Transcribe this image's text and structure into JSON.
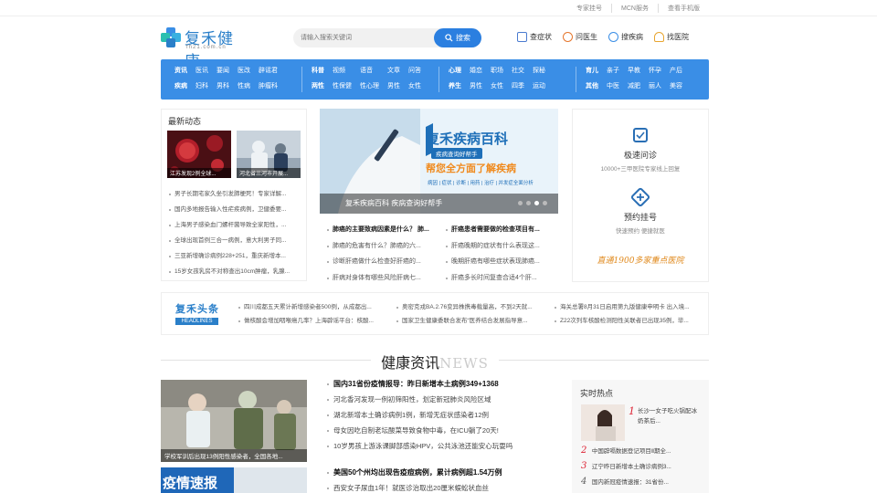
{
  "topbar": {
    "links": [
      "专家挂号",
      "MCN服务",
      "查看手机版"
    ]
  },
  "logo": {
    "name": "复禾健康",
    "domain": "fh21.com.cn"
  },
  "search": {
    "placeholder": "请输入搜索关键词",
    "button": "搜索"
  },
  "header_nav": [
    {
      "label": "查症状",
      "icon": "book-icon",
      "color": "#4a7bd0"
    },
    {
      "label": "问医生",
      "icon": "doctor-icon",
      "color": "#e5762c"
    },
    {
      "label": "搜疾病",
      "icon": "disease-icon",
      "color": "#3a8ee6"
    },
    {
      "label": "找医院",
      "icon": "hospital-icon",
      "color": "#e8a530"
    }
  ],
  "categories": [
    {
      "row1": [
        "资讯",
        "医讯",
        "要闻",
        "医改",
        "辟谣君"
      ],
      "row2": [
        "疾病",
        "妇科",
        "男科",
        "性病",
        "肿瘤科"
      ],
      "bold": [
        0
      ]
    },
    {
      "row1": [
        "科普",
        "视频",
        "语音",
        "文章",
        "问答"
      ],
      "row2": [
        "两性",
        "性保健",
        "性心理",
        "男性",
        "女性"
      ],
      "bold": [
        0
      ]
    },
    {
      "row1": [
        "心理",
        "婚恋",
        "职场",
        "社交",
        "探秘"
      ],
      "row2": [
        "养生",
        "男性",
        "女性",
        "四季",
        "运动"
      ],
      "bold": [
        0
      ]
    },
    {
      "row1": [
        "育儿",
        "亲子",
        "早教",
        "怀孕",
        "产后"
      ],
      "row2": [
        "其他",
        "中医",
        "减肥",
        "丽人",
        "美容"
      ],
      "bold": [
        0
      ]
    }
  ],
  "latest": {
    "title": "最新动态",
    "thumbs": [
      "江苏发现2例全球...",
      "河北省三河市开展..."
    ],
    "items": [
      "男子长期宅家久坐引发肺梗死！专家详解...",
      "国内多地报告输入性疟疾病例，卫健委要...",
      "上海男子感染血门螺杆菌导致全家阳性，...",
      "全球出现首例三合一病例，意大利男子同...",
      "三亚新增确诊病例228+251，重庆新增本...",
      "15岁女孩乳房不对称查出10cm肿瘤，乳腺..."
    ]
  },
  "banner": {
    "title": "复禾疾病百科",
    "tag": "疾病查询好帮手",
    "slogan": "帮您全方面了解疾病",
    "subline": "病因 | 症状 | 诊断 | 用药 | 治疗 | 并发症全面分析",
    "caption": "复禾疾病百科 疾病查询好帮手"
  },
  "mid_news": [
    {
      "text": "肺癌的主要致病因素是什么？ 肺...",
      "bold": true
    },
    {
      "text": "肝癌患者需要做的检查项目有...",
      "bold": true
    },
    {
      "text": "肺癌的危害有什么？肺癌的六...",
      "bold": false
    },
    {
      "text": "肝癌晚期的症状有什么表现这...",
      "bold": false
    },
    {
      "text": "诊断肝癌做什么检查好肝癌的...",
      "bold": false
    },
    {
      "text": "晚期肝癌有哪些症状表现肺癌...",
      "bold": false
    },
    {
      "text": "肝病对身体有哪些风险肝病七...",
      "bold": false
    },
    {
      "text": "肝癌多长时间复查合适4个肝...",
      "bold": false
    }
  ],
  "services": [
    {
      "title": "极速问诊",
      "desc": "10000+三甲医院专家线上回复",
      "icon": "clipboard-icon"
    },
    {
      "title": "预约挂号",
      "desc": "快速预约  便捷就医",
      "icon": "plus-shield-icon"
    }
  ],
  "hotline": "直通1900多家重点医院",
  "headlines": {
    "logo_cn": "复禾头条",
    "logo_en": "HEADLINES",
    "items": [
      "四川成都五天累计新增感染者500例，从成都出...",
      "奥密克戎BA.2.76变异株携毒载量高，不到2天就...",
      "海关总署8月31日启用第九版健康申明卡 出入境...",
      "做核酸会增加咽喉癌几率？上海辟谣平台：核酸...",
      "国家卫生健康委联合发布“医养结合发展指导意...",
      "Z22次列车核酸检测阳性关联者已出现35例，毕..."
    ]
  },
  "section": {
    "title": "健康资讯",
    "en": "NEWS"
  },
  "news_img_caption": "学校军训后出现13例阳性感染者，全国各地...",
  "news_group1": [
    {
      "text": "国内31省份疫情报导：昨日新增本土病例349+1368",
      "bold": true
    },
    {
      "text": "河北香河发现一例初筛阳性，划定新冠肺炎风险区域",
      "bold": false
    },
    {
      "text": "湖北新增本土确诊病例1例，新增无症状感染者12例",
      "bold": false
    },
    {
      "text": "母女因吃自制老坛酸菜导致食物中毒，在ICU躺了20天!",
      "bold": false
    },
    {
      "text": "10岁男孩上游泳课脚部感染HPV，公共泳池还能安心玩耍吗",
      "bold": false
    }
  ],
  "news_group2": [
    {
      "text": "美国50个州均出现告疫痘病例，累计病例超1.54万例",
      "bold": true
    },
    {
      "text": "西安女子尿血1年！就医诊治取出20厘米蜈蚣状血丝",
      "bold": false
    }
  ],
  "news_img2_text": "疫情速报",
  "hot": {
    "title": "实时热点",
    "first": {
      "num": "1",
      "text": "长沙一女子吃火锅配冰奶茶后..."
    },
    "items": [
      {
        "num": "2",
        "text": "中国辟嗝数据登记项目Ⅱ期全..."
      },
      {
        "num": "3",
        "text": "辽宁昨日新增本土确诊病例3..."
      },
      {
        "num": "4",
        "text": "国内新冠疫情速报：31省份..."
      }
    ]
  },
  "colors": {
    "brand": "#2a7fc9",
    "accent": "#3a8ee6",
    "button": "#2b7fe0",
    "hot_num": "#d23"
  }
}
